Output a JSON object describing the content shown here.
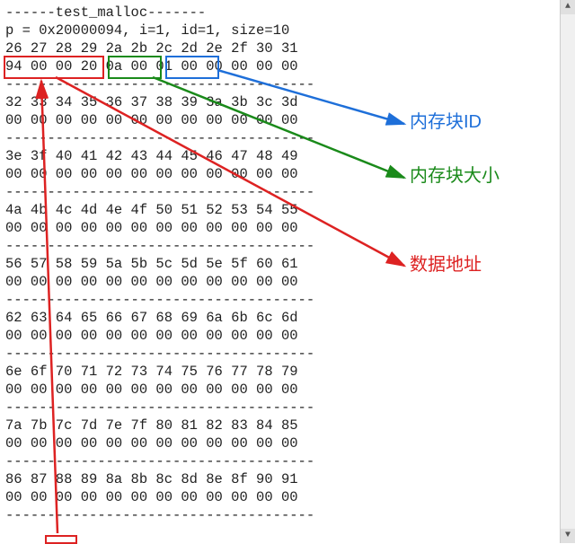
{
  "header": {
    "title_line": "------test_malloc-------",
    "info_line": "p = 0x20000094, i=1, id=1, size=10"
  },
  "highlight": {
    "data_addr_bytes": "94 00 00 20",
    "block_size_bytes": "0a 00",
    "block_id_bytes": "01 00"
  },
  "labels": {
    "block_id": "内存块ID",
    "block_size": "内存块大小",
    "data_addr": "数据地址"
  },
  "dump": [
    {
      "offsets": "26 27 28 29 2a 2b 2c 2d 2e 2f 30 31",
      "bytes": "94 00 00 20 0a 00 01 00 00 00 00 00"
    },
    {
      "offsets": "32 33 34 35 36 37 38 39 3a 3b 3c 3d",
      "bytes": "00 00 00 00 00 00 00 00 00 00 00 00"
    },
    {
      "offsets": "3e 3f 40 41 42 43 44 45 46 47 48 49",
      "bytes": "00 00 00 00 00 00 00 00 00 00 00 00"
    },
    {
      "offsets": "4a 4b 4c 4d 4e 4f 50 51 52 53 54 55",
      "bytes": "00 00 00 00 00 00 00 00 00 00 00 00"
    },
    {
      "offsets": "56 57 58 59 5a 5b 5c 5d 5e 5f 60 61",
      "bytes": "00 00 00 00 00 00 00 00 00 00 00 00"
    },
    {
      "offsets": "62 63 64 65 66 67 68 69 6a 6b 6c 6d",
      "bytes": "00 00 00 00 00 00 00 00 00 00 00 00"
    },
    {
      "offsets": "6e 6f 70 71 72 73 74 75 76 77 78 79",
      "bytes": "00 00 00 00 00 00 00 00 00 00 00 00"
    },
    {
      "offsets": "7a 7b 7c 7d 7e 7f 80 81 82 83 84 85",
      "bytes": "00 00 00 00 00 00 00 00 00 00 00 00"
    },
    {
      "offsets": "86 87 88 89 8a 8b 8c 8d 8e 8f 90 91",
      "bytes": "00 00 00 00 00 00 00 00 00 00 00 00"
    }
  ],
  "separator": "-------------------------------------"
}
